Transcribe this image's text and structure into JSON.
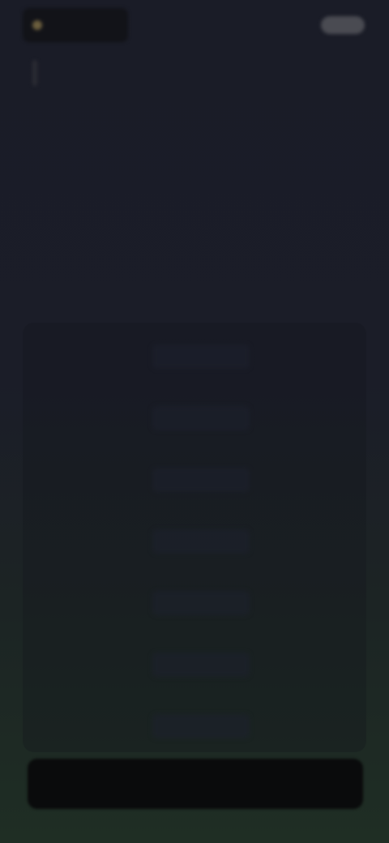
{
  "header": {
    "logo_text": "",
    "right_text": ""
  },
  "hero": {
    "title": "",
    "subtitle": ""
  },
  "rows": [
    {
      "label": "",
      "value": ""
    },
    {
      "label": "",
      "value": ""
    },
    {
      "label": "",
      "value": ""
    },
    {
      "label": "",
      "value": ""
    },
    {
      "label": "",
      "value": ""
    },
    {
      "label": "",
      "value": ""
    },
    {
      "label": "",
      "value": ""
    }
  ],
  "cta": {
    "label": ""
  },
  "colors": {
    "background_top": "#1a1c27",
    "background_bottom": "#1f2e24",
    "button": "#0a0b0c"
  }
}
